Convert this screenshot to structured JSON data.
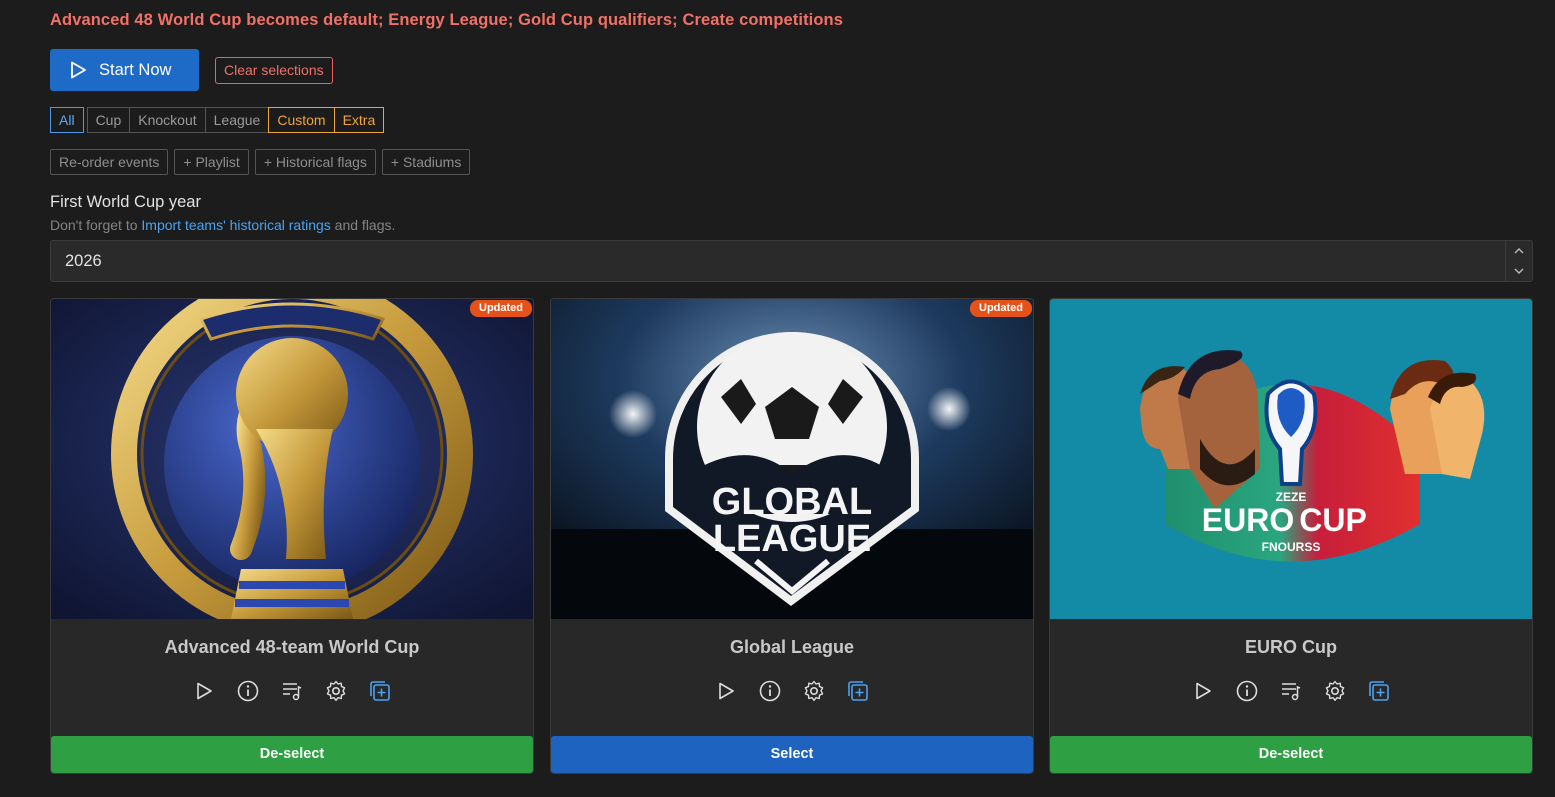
{
  "announcement": "Advanced 48 World Cup becomes default; Energy League; Gold Cup qualifiers; Create competitions",
  "actions": {
    "start_label": "Start Now",
    "clear_label": "Clear selections"
  },
  "filters": [
    "All",
    "Cup",
    "Knockout",
    "League",
    "Custom",
    "Extra"
  ],
  "tools": [
    "Re-order events",
    "+ Playlist",
    "+ Historical flags",
    "+ Stadiums"
  ],
  "year_section": {
    "label": "First World Cup year",
    "hint_prefix": "Don't forget to ",
    "hint_link": "Import teams' historical ratings",
    "hint_suffix": " and flags.",
    "value": "2026"
  },
  "cards": [
    {
      "title": "Advanced 48-team World Cup",
      "badge": "Updated",
      "button": "De-select",
      "button_color": "#2ea043"
    },
    {
      "title": "Global League",
      "badge": "Updated",
      "button": "Select",
      "button_color": "#1e63c0"
    },
    {
      "title": "EURO Cup",
      "badge": "",
      "button": "De-select",
      "button_color": "#2ea043"
    }
  ],
  "images": {
    "global_league_text_1": "GLOBAL",
    "global_league_text_2": "LEAGUE",
    "euro_text": "EURO",
    "euro_text_2": "CUP",
    "euro_sub": "FNOURSS",
    "euro_top": "ZEZE"
  },
  "colors": {
    "accent_blue": "#1e6bc7",
    "select_green": "#2ea043",
    "warning_red": "#f07167",
    "badge_orange": "#e4521a",
    "filter_orange": "#f0a43a"
  }
}
